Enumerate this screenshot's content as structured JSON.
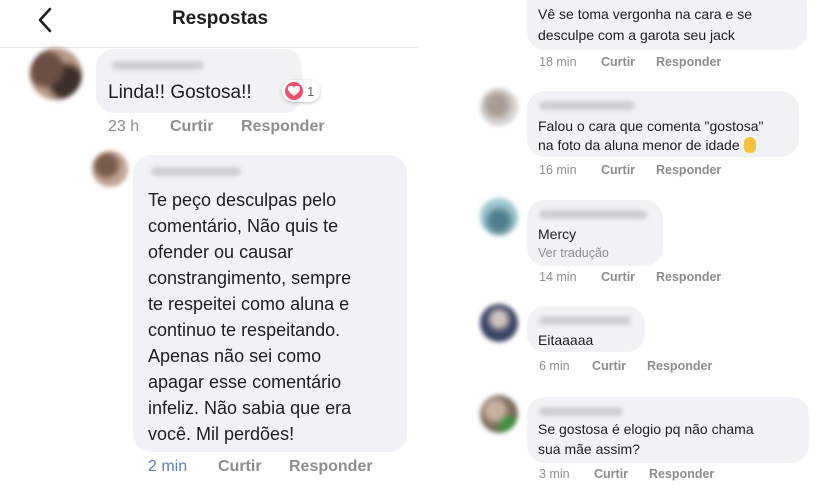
{
  "header": {
    "title": "Respostas"
  },
  "left": {
    "comment1": {
      "text": "Linda!! Gostosa!!",
      "reaction_count": "1",
      "time": "23 h",
      "like": "Curtir",
      "reply": "Responder"
    },
    "comment2": {
      "lines": [
        "Te peço desculpas pelo",
        "comentário, Não quis te",
        "ofender ou causar",
        "constrangimento, sempre",
        "te respeitei como aluna e",
        "continuo te respeitando.",
        "Apenas não sei como",
        "apagar esse comentário",
        "infeliz. Não sabia que era",
        "você. Mil perdões!"
      ],
      "time": "2 min",
      "like": "Curtir",
      "reply": "Responder"
    }
  },
  "right": {
    "c1": {
      "lines": [
        "Vê se toma vergonha na cara e se",
        "desculpe com a garota seu jack"
      ],
      "time": "18 min",
      "like": "Curtir",
      "reply": "Responder"
    },
    "c2": {
      "lines": [
        "Falou o cara que comenta \"gostosa\"",
        "na foto da aluna menor de idade"
      ],
      "time": "16 min",
      "like": "Curtir",
      "reply": "Responder"
    },
    "c3": {
      "text": "Mercy",
      "translation": "Ver tradução",
      "time": "14 min",
      "like": "Curtir",
      "reply": "Responder"
    },
    "c4": {
      "text": "Eitaaaaa",
      "time": "6 min",
      "like": "Curtir",
      "reply": "Responder"
    },
    "c5": {
      "lines": [
        "Se gostosa é elogio pq não chama",
        "sua mãe assim?"
      ],
      "time": "3 min",
      "like": "Curtir",
      "reply": "Responder"
    }
  },
  "colors": {
    "bubble": "#f0f2f5",
    "meta": "#8a8d91",
    "heart": "#f0506e",
    "time_blue": "#5b7fb3"
  },
  "icons": [
    "back-arrow-icon",
    "heart-reaction-icon",
    "ok-hand-emoji-icon"
  ]
}
